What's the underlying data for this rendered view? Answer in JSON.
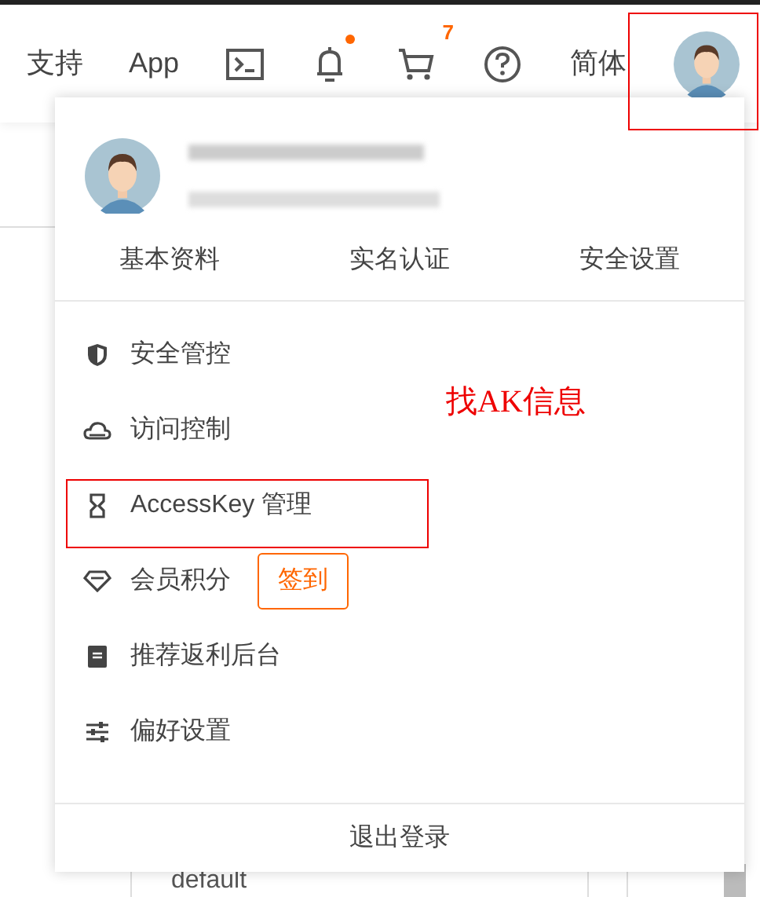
{
  "nav": {
    "items": [
      {
        "kind": "text",
        "label": "支持"
      },
      {
        "kind": "text",
        "label": "App"
      },
      {
        "kind": "icon"
      },
      {
        "kind": "icon",
        "unread": true
      },
      {
        "kind": "icon",
        "badge": "7"
      },
      {
        "kind": "icon"
      },
      {
        "kind": "text",
        "label": "简体"
      },
      {
        "kind": "avatar"
      }
    ]
  },
  "account_menu": {
    "tabs": [
      {
        "label": "基本资料"
      },
      {
        "label": "实名认证"
      },
      {
        "label": "安全设置"
      }
    ],
    "items": [
      {
        "label": "安全管控"
      },
      {
        "label": "访问控制"
      },
      {
        "label": "AccessKey 管理"
      },
      {
        "label": "会员积分",
        "button": "签到"
      },
      {
        "label": "推荐返利后台"
      },
      {
        "label": "偏好设置"
      }
    ],
    "logout": "退出登录"
  },
  "annotation": {
    "text": "找AK信息"
  },
  "background": {
    "cell": "default"
  }
}
